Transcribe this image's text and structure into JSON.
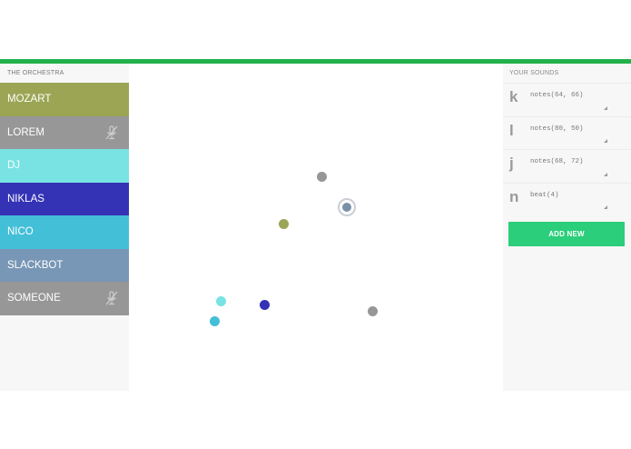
{
  "left": {
    "header": "THE ORCHESTRA",
    "players": [
      {
        "name": "MOZART",
        "color": "#9ba554",
        "muted": false
      },
      {
        "name": "LOREM",
        "color": "#979797",
        "muted": true
      },
      {
        "name": "DJ",
        "color": "#79e3e3",
        "muted": false
      },
      {
        "name": "NIKLAS",
        "color": "#3432b5",
        "muted": false
      },
      {
        "name": "NICO",
        "color": "#44bfd8",
        "muted": false
      },
      {
        "name": "SLACKBOT",
        "color": "#7896b5",
        "muted": false
      },
      {
        "name": "SOMEONE",
        "color": "#979797",
        "muted": true
      }
    ]
  },
  "right": {
    "header": "YOUR SOUNDS",
    "sounds": [
      {
        "key": "k",
        "code": "notes(64, 66)"
      },
      {
        "key": "l",
        "code": "notes(80, 50)"
      },
      {
        "key": "j",
        "code": "notes(68, 72)"
      },
      {
        "key": "n",
        "code": "beat(4)"
      }
    ],
    "add_button": "ADD NEW"
  },
  "colors": {
    "accent_bar": "#22b14c",
    "add_button": "#2bce7a",
    "stage_dots": [
      "#979797",
      "#7a90a8",
      "#9ba554",
      "#79e3e3",
      "#3432b5",
      "#44bfd8",
      "#979797"
    ]
  }
}
